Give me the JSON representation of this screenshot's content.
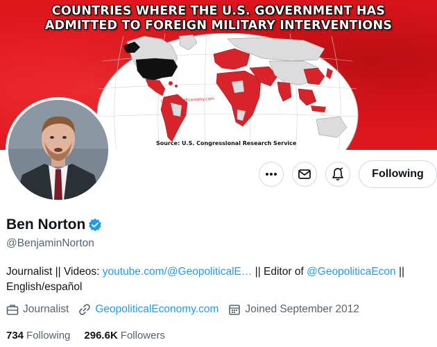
{
  "banner": {
    "title_line1": "COUNTRIES WHERE THE U.S. GOVERNMENT HAS",
    "title_line2": "ADMITTED TO FOREIGN MILITARY INTERVENTIONS",
    "source": "Source: U.S. Congressional Research Service",
    "watermark": "GeopoliticalEconomy.com",
    "colors": {
      "background": "#e0161d",
      "intervention": "#d9232b",
      "usa": "#111111",
      "other": "#dcdcdc"
    }
  },
  "actions": {
    "more_icon": "ellipsis-icon",
    "message_icon": "envelope-icon",
    "notify_icon": "bell-icon",
    "follow_label": "Following"
  },
  "profile": {
    "name": "Ben Norton",
    "handle": "@BenjaminNorton",
    "verified": true,
    "bio": {
      "prefix": "Journalist || Videos: ",
      "link1": "youtube.com/@GeopoliticalE…",
      "middle": " || Editor of ",
      "link2": "@GeopoliticaEcon",
      "suffix": " ||",
      "line2": "English/español"
    },
    "meta": {
      "profession": "Journalist",
      "website": "GeopoliticalEconomy.com",
      "joined": "Joined September 2012"
    },
    "stats": {
      "following_count": "734",
      "following_label": "Following",
      "followers_count": "296.6K",
      "followers_label": "Followers"
    }
  },
  "colors": {
    "accent": "#1d9bf0",
    "muted": "#536471",
    "text": "#0f1419"
  }
}
